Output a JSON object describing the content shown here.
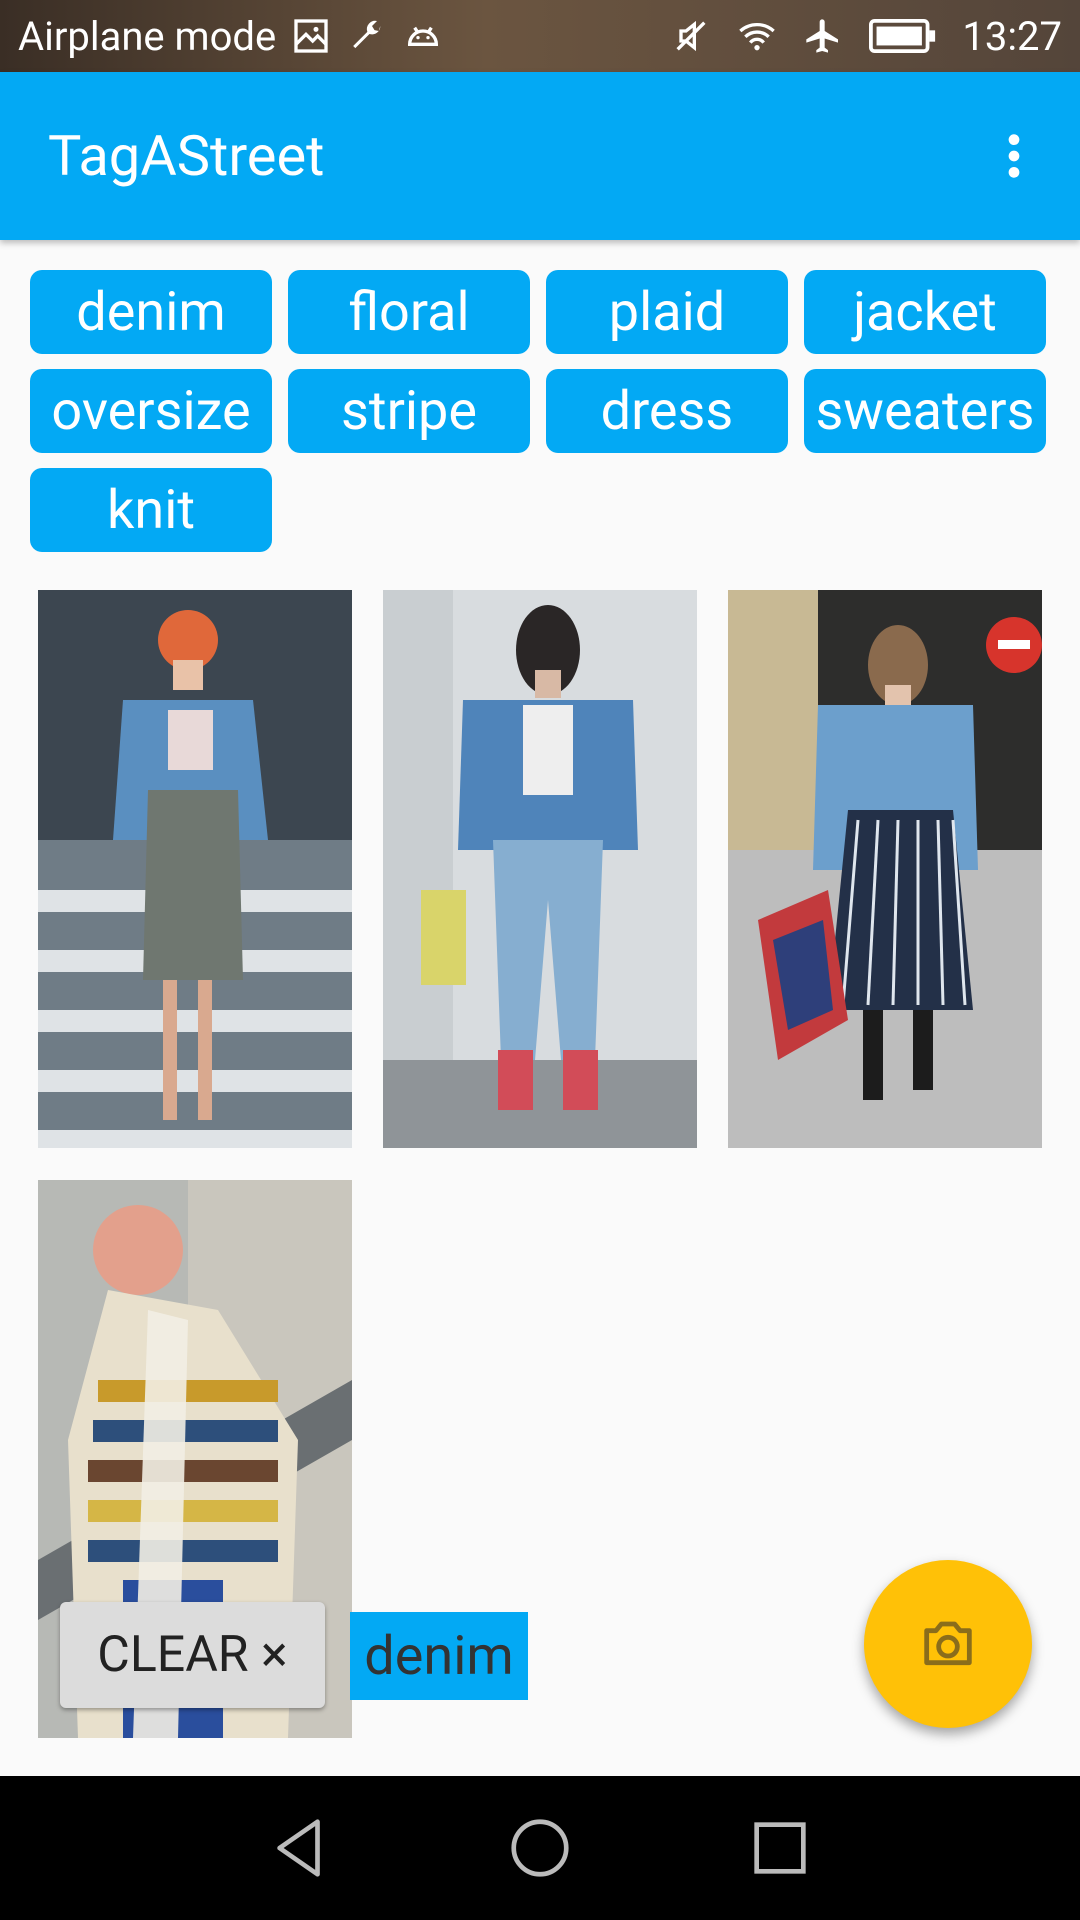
{
  "status_bar": {
    "left_text": "Airplane mode",
    "time": "13:27",
    "icons": [
      "image-icon",
      "wrench-icon",
      "android-icon",
      "mute-icon",
      "wifi-icon",
      "airplane-icon",
      "battery-icon"
    ]
  },
  "app_bar": {
    "title": "TagAStreet",
    "menu_icon": "more-vert-icon"
  },
  "tags": [
    "denim",
    "floral",
    "plaid",
    "jacket",
    "oversize",
    "stripe",
    "dress",
    "sweaters",
    "knit"
  ],
  "photos": [
    {
      "name": "photo-denim-jacket-plaid-skirt"
    },
    {
      "name": "photo-denim-jacket-jeans"
    },
    {
      "name": "photo-denim-jacket-stripe-dress"
    },
    {
      "name": "photo-knit-sweater-coat"
    }
  ],
  "filter": {
    "clear_label": "CLEAR ×",
    "active_tag": "denim"
  },
  "fab": {
    "icon": "camera-icon"
  },
  "colors": {
    "primary": "#03a9f4",
    "accent": "#ffc107",
    "background": "#fafafa"
  }
}
